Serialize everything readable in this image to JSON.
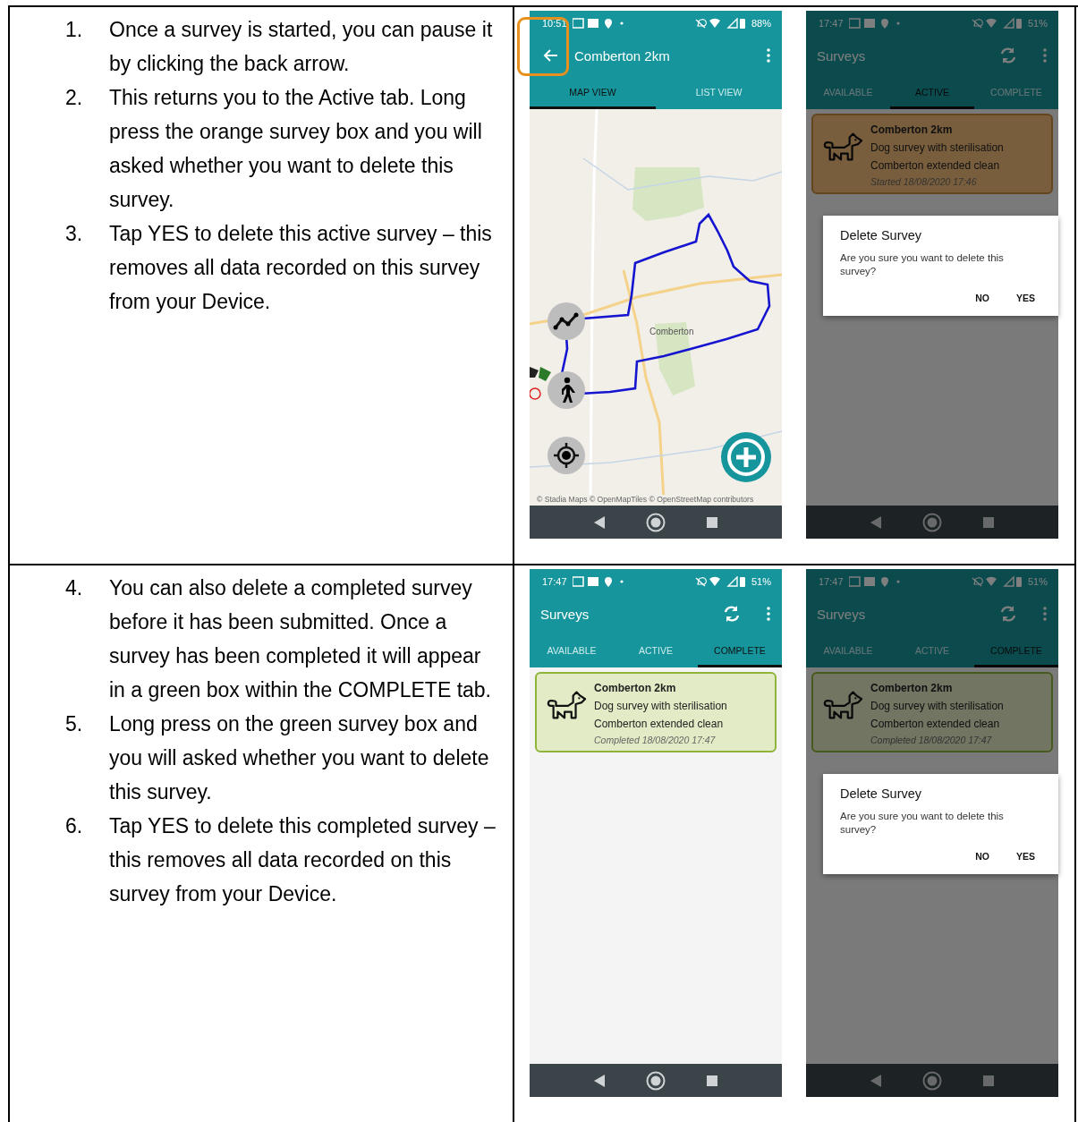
{
  "rows": [
    {
      "steps": [
        {
          "number": "1.",
          "text": "Once a survey is started, you can pause it by clicking the back arrow."
        },
        {
          "number": "2.",
          "text": "This returns you to the Active tab. Long press the orange survey box and you will asked whether you want to delete this survey."
        },
        {
          "number": "3.",
          "text": "Tap YES to delete this active survey – this removes all data recorded on this survey from your Device."
        }
      ],
      "phones": [
        {
          "kind": "map",
          "status": {
            "time": "10:51",
            "battery": "88%"
          },
          "title": "Comberton 2km",
          "back_button": true,
          "back_highlighted": true,
          "sync_button": false,
          "tabs": [
            {
              "label": "MAP VIEW",
              "selected": true
            },
            {
              "label": "LIST VIEW",
              "selected": false
            }
          ],
          "map": {
            "place_label": "Comberton",
            "attribution": "© Stadia Maps © OpenMapTiles © OpenStreetMap contributors"
          }
        },
        {
          "kind": "list",
          "status": {
            "time": "17:47",
            "battery": "51%"
          },
          "title": "Surveys",
          "back_button": false,
          "back_highlighted": false,
          "sync_button": true,
          "tabs": [
            {
              "label": "AVAILABLE",
              "selected": false
            },
            {
              "label": "ACTIVE",
              "selected": true
            },
            {
              "label": "COMPLETE",
              "selected": false
            }
          ],
          "card": {
            "kind": "active",
            "title": "Comberton 2km",
            "lines": [
              "Dog survey with sterilisation",
              "Comberton extended clean"
            ],
            "footer": "Started 18/08/2020 17:46"
          },
          "dialog": {
            "title": "Delete Survey",
            "message": "Are you sure you want to delete this survey?",
            "buttons": [
              "NO",
              "YES"
            ]
          }
        }
      ]
    },
    {
      "steps": [
        {
          "number": "4.",
          "text": "You can also delete a completed survey before it has been submitted. Once a survey has been completed it will appear in a green box within the COMPLETE tab."
        },
        {
          "number": "5.",
          "text": "Long press on the green survey box and you will asked whether you want to delete this survey."
        },
        {
          "number": "6.",
          "text": "Tap YES to delete this completed survey – this removes all data recorded on this survey from your Device."
        }
      ],
      "phones": [
        {
          "kind": "list",
          "status": {
            "time": "17:47",
            "battery": "51%"
          },
          "title": "Surveys",
          "back_button": false,
          "back_highlighted": false,
          "sync_button": true,
          "tabs": [
            {
              "label": "AVAILABLE",
              "selected": false
            },
            {
              "label": "ACTIVE",
              "selected": false
            },
            {
              "label": "COMPLETE",
              "selected": true
            }
          ],
          "card": {
            "kind": "complete",
            "title": "Comberton 2km",
            "lines": [
              "Dog survey with sterilisation",
              "Comberton extended clean"
            ],
            "footer": "Completed 18/08/2020 17:47"
          }
        },
        {
          "kind": "list",
          "status": {
            "time": "17:47",
            "battery": "51%"
          },
          "title": "Surveys",
          "back_button": false,
          "back_highlighted": false,
          "sync_button": true,
          "tabs": [
            {
              "label": "AVAILABLE",
              "selected": false
            },
            {
              "label": "ACTIVE",
              "selected": false
            },
            {
              "label": "COMPLETE",
              "selected": true
            }
          ],
          "card": {
            "kind": "complete",
            "title": "Comberton 2km",
            "lines": [
              "Dog survey with sterilisation",
              "Comberton extended clean"
            ],
            "footer": "Completed 18/08/2020 17:47"
          },
          "dialog": {
            "title": "Delete Survey",
            "message": "Are you sure you want to delete this survey?",
            "buttons": [
              "NO",
              "YES"
            ]
          }
        }
      ]
    }
  ]
}
